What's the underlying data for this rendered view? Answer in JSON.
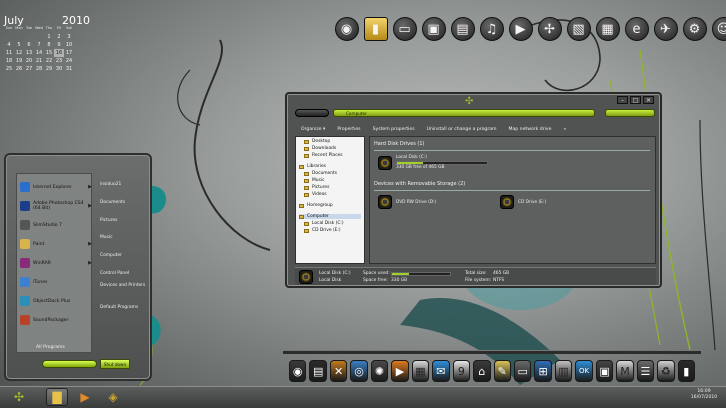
{
  "calendar": {
    "month": "July",
    "year": "2010",
    "weekdays": [
      "Sun",
      "Mon",
      "Tue",
      "Wed",
      "Thu",
      "Fri",
      "Sat"
    ],
    "days": [
      "",
      "",
      "",
      "",
      "1",
      "2",
      "3",
      "4",
      "5",
      "6",
      "7",
      "8",
      "9",
      "10",
      "11",
      "12",
      "13",
      "14",
      "15",
      "16",
      "17",
      "18",
      "19",
      "20",
      "21",
      "22",
      "23",
      "24",
      "25",
      "26",
      "27",
      "28",
      "29",
      "30",
      "31"
    ],
    "today": "16"
  },
  "top_dock": [
    "camera-icon",
    "folder-icon",
    "computer-icon",
    "camera-folder-icon",
    "documents-icon",
    "headphones-icon",
    "video-icon",
    "acrobat-icon",
    "picture-icon",
    "calculator-icon",
    "internet-explorer-icon",
    "bird-icon",
    "settings-icon",
    "contacts-icon"
  ],
  "start_menu": {
    "programs": [
      {
        "label": "Internet Explorer",
        "color": "#2a6fcf",
        "arrow": "▶"
      },
      {
        "label": "Adobe Photoshop CS4 (64 Bit)",
        "color": "#1b3e8a",
        "arrow": "▶"
      },
      {
        "label": "SlimStudio 7",
        "color": "#555555",
        "arrow": ""
      },
      {
        "label": "Paint",
        "color": "#d9b24c",
        "arrow": "▶"
      },
      {
        "label": "WinRAR",
        "color": "#8a2a7a",
        "arrow": "▶"
      },
      {
        "label": "iTunes",
        "color": "#3d7fd1",
        "arrow": ""
      },
      {
        "label": "ObjectDock Plus",
        "color": "#2b8fb8",
        "arrow": ""
      },
      {
        "label": "SoundPackager",
        "color": "#b8422a",
        "arrow": ""
      }
    ],
    "right_links": [
      "insiduo21",
      "Documents",
      "Pictures",
      "Music",
      "Computer",
      "Control Panel",
      "Devices and Printers",
      "Default Programs"
    ],
    "all_programs": "All Programs",
    "shutdown": "Shut down"
  },
  "explorer": {
    "address": "Computer",
    "toolbar": [
      "Organize ▾",
      "Properties",
      "System properties",
      "Uninstall or change a program",
      "Map network drive",
      "»"
    ],
    "nav_items": [
      "Desktop",
      "Downloads",
      "Recent Places",
      "Libraries",
      "Documents",
      "Music",
      "Pictures",
      "Videos",
      "Homegroup",
      "Computer",
      "Local Disk (C:)",
      "CD Drive (E:)"
    ],
    "section_hdd": "Hard Disk Drives (1)",
    "section_removable": "Devices with Removable Storage (2)",
    "local_disk": {
      "name": "Local Disk (C:)",
      "free": "330 GB free of 465 GB",
      "used_fraction": 0.29
    },
    "dvd": "DVD RW Drive (D:)",
    "cd": "CD Drive (E:)",
    "details": {
      "name": "Local Disk (C:)",
      "type": "Local Disk",
      "space_used_label": "Space used:",
      "space_free_label": "Space free:",
      "space_free": "330 GB",
      "total_label": "Total size:",
      "total": "465 GB",
      "fs_label": "File system:",
      "fs": "NTFS"
    }
  },
  "bottom_dock": [
    {
      "icon": "drive-icon",
      "color": "#3a3a3a",
      "glyph": "◉"
    },
    {
      "icon": "film-icon",
      "color": "#2a2a2a",
      "glyph": "▤"
    },
    {
      "icon": "tools-icon",
      "color": "#c07b1e",
      "glyph": "✕"
    },
    {
      "icon": "network-icon",
      "color": "#3a7fc2",
      "glyph": "◎"
    },
    {
      "icon": "hub-icon",
      "color": "#4a4a4a",
      "glyph": "✺"
    },
    {
      "icon": "media-icon",
      "color": "#e07a1e",
      "glyph": "▶"
    },
    {
      "icon": "documents-icon",
      "color": "#d9d9d9",
      "glyph": "▦"
    },
    {
      "icon": "chat-icon",
      "color": "#2f8fd9",
      "glyph": "✉"
    },
    {
      "icon": "calendar-icon",
      "color": "#e8e8e8",
      "glyph": "9"
    },
    {
      "icon": "trash-icon",
      "color": "#3a3a3a",
      "glyph": "⌂"
    },
    {
      "icon": "paint-icon",
      "color": "#d8c35a",
      "glyph": "✎"
    },
    {
      "icon": "monitor-icon",
      "color": "#6a6a6a",
      "glyph": "▭"
    },
    {
      "icon": "windows-icon",
      "color": "#2f6fb8",
      "glyph": "⊞"
    },
    {
      "icon": "chart-icon",
      "color": "#c0c0c0",
      "glyph": "▥"
    },
    {
      "icon": "ok-icon",
      "color": "#2f8fd9",
      "glyph": "OK"
    },
    {
      "icon": "tv-icon",
      "color": "#444444",
      "glyph": "▣"
    },
    {
      "icon": "mail-icon",
      "color": "#d9d9d9",
      "glyph": "M"
    },
    {
      "icon": "tasks-icon",
      "color": "#6a6a6a",
      "glyph": "☰"
    },
    {
      "icon": "recycle-icon",
      "color": "#d0d0d0",
      "glyph": "♻"
    },
    {
      "icon": "terminal-icon",
      "color": "#2a2a2a",
      "glyph": "▮"
    }
  ],
  "taskbar": {
    "time": "16:09",
    "date": "16/07/2010"
  }
}
